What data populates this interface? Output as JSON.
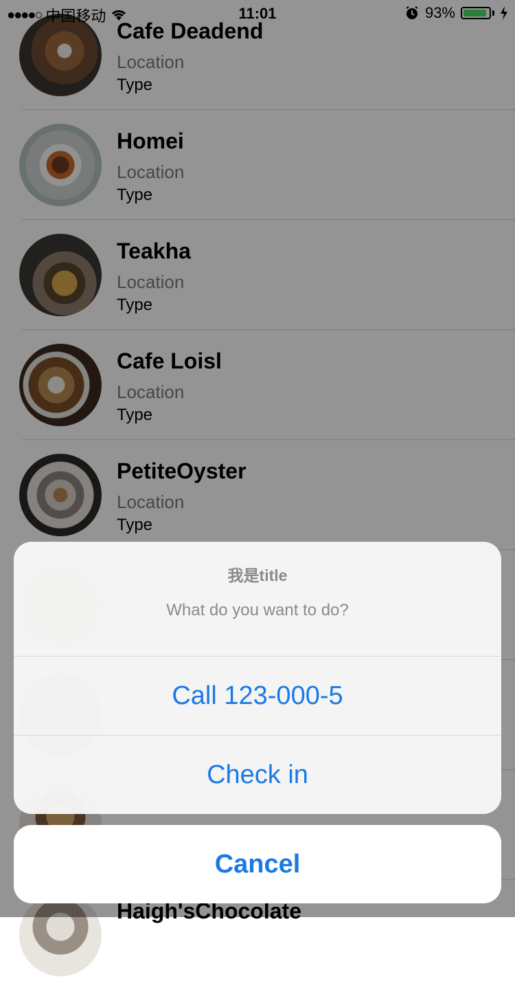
{
  "status_bar": {
    "signal_dots": "●●●●○",
    "carrier": "中国移动",
    "time": "11:01",
    "battery_percent": "93%",
    "battery_level": 0.93
  },
  "list": {
    "rows": [
      {
        "name": "Cafe Deadend",
        "location": "Location",
        "type": "Type"
      },
      {
        "name": "Homei",
        "location": "Location",
        "type": "Type"
      },
      {
        "name": "Teakha",
        "location": "Location",
        "type": "Type"
      },
      {
        "name": "Cafe Loisl",
        "location": "Location",
        "type": "Type"
      },
      {
        "name": "PetiteOyster",
        "location": "Location",
        "type": "Type"
      },
      {
        "name": "Haigh'sChocolate",
        "location": "",
        "type": ""
      }
    ]
  },
  "action_sheet": {
    "title": "我是title",
    "message": "What do you want to do?",
    "call_label": "Call 123-000-5",
    "checkin_label": "Check in",
    "cancel_label": "Cancel"
  },
  "colors": {
    "accent": "#1a7ae4",
    "battery": "#4cd964"
  }
}
